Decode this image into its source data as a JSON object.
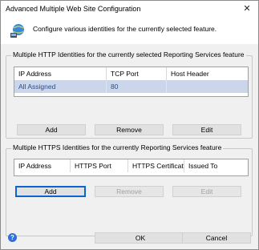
{
  "window": {
    "title": "Advanced Multiple Web Site Configuration",
    "description": "Configure various identities for the currently selected feature."
  },
  "http_group": {
    "legend": "Multiple HTTP Identities for the currently selected Reporting Services feature",
    "columns": [
      "IP Address",
      "TCP Port",
      "Host Header"
    ],
    "rows": [
      [
        "All Assigned",
        "80",
        ""
      ]
    ],
    "buttons": {
      "add": "Add",
      "remove": "Remove",
      "edit": "Edit"
    }
  },
  "https_group": {
    "legend": "Multiple HTTPS Identities for the currently Reporting Services feature",
    "columns": [
      "IP Address",
      "HTTPS Port",
      "HTTPS Certificate",
      "Issued To"
    ],
    "rows": [],
    "buttons": {
      "add": "Add",
      "remove": "Remove",
      "edit": "Edit"
    }
  },
  "footer": {
    "ok": "OK",
    "cancel": "Cancel"
  },
  "icons": {
    "close": "close-icon",
    "header": "network-icon",
    "help": "help-icon"
  },
  "colors": {
    "selected_row": "#ccd6eb",
    "focus_border": "#0a64d2"
  }
}
